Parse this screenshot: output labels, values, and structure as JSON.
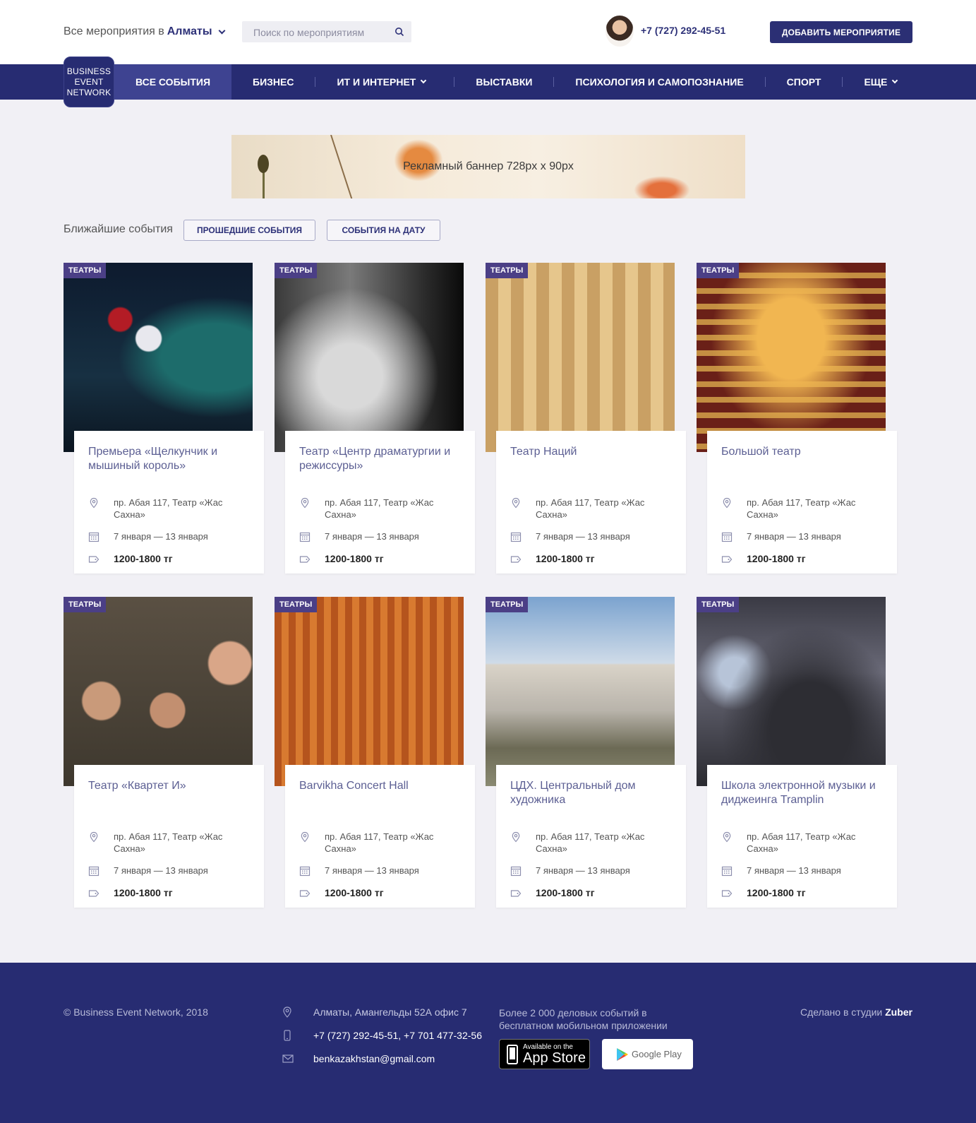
{
  "header": {
    "city_prefix": "Все мероприятия в",
    "city": "Алматы",
    "search_placeholder": "Поиск по мероприятиям",
    "phone": "+7 (727) 292-45-51",
    "add_button": "ДОБАВИТЬ МЕРОПРИЯТИЕ"
  },
  "logo": {
    "line1": "BUSINESS",
    "line2": "EVENT",
    "line3": "NETWORK"
  },
  "nav": {
    "items": [
      {
        "label": "ВСЕ СОБЫТИЯ",
        "active": true
      },
      {
        "label": "БИЗНЕС"
      },
      {
        "label": "ИТ И ИНТЕРНЕТ",
        "dropdown": true
      },
      {
        "label": "ВЫСТАВКИ"
      },
      {
        "label": "ПСИХОЛОГИЯ И САМОПОЗНАНИЕ"
      },
      {
        "label": "СПОРТ"
      },
      {
        "label": "ЕЩЕ",
        "dropdown": true
      }
    ]
  },
  "banner": {
    "text": "Рекламный баннер 728px x 90px"
  },
  "filters": {
    "label": "Ближайшие события",
    "past": "ПРОШЕДШИЕ СОБЫТИЯ",
    "by_date": "СОБЫТИЯ НА ДАТУ"
  },
  "events": [
    {
      "tag": "ТЕАТРЫ",
      "title": "Премьера «Щелкунчик и мышиный король»",
      "address": "пр. Абая 117, Театр «Жас Сахна»",
      "dates": "7 января — 13 января",
      "price": "1200-1800 тг"
    },
    {
      "tag": "ТЕАТРЫ",
      "title": "Театр «Центр драматургии и режиссуры»",
      "address": "пр. Абая 117, Театр «Жас Сахна»",
      "dates": "7 января — 13 января",
      "price": "1200-1800 тг"
    },
    {
      "tag": "ТЕАТРЫ",
      "title": "Театр Наций",
      "address": "пр. Абая 117, Театр «Жас Сахна»",
      "dates": "7 января — 13 января",
      "price": "1200-1800 тг"
    },
    {
      "tag": "ТЕАТРЫ",
      "title": "Большой театр",
      "address": "пр. Абая 117, Театр «Жас Сахна»",
      "dates": "7 января — 13 января",
      "price": "1200-1800 тг"
    },
    {
      "tag": "ТЕАТРЫ",
      "title": "Театр «Квартет И»",
      "address": "пр. Абая 117, Театр «Жас Сахна»",
      "dates": "7 января — 13 января",
      "price": "1200-1800 тг"
    },
    {
      "tag": "ТЕАТРЫ",
      "title": "Barvikha Concert Hall",
      "address": "пр. Абая 117, Театр «Жас Сахна»",
      "dates": "7 января — 13 января",
      "price": "1200-1800 тг"
    },
    {
      "tag": "ТЕАТРЫ",
      "title": "ЦДХ. Центральный дом художника",
      "address": "пр. Абая 117, Театр «Жас Сахна»",
      "dates": "7 января — 13 января",
      "price": "1200-1800 тг"
    },
    {
      "tag": "ТЕАТРЫ",
      "title": "Школа электронной музыки и диджеинга Tramplin",
      "address": "пр. Абая 117, Театр «Жас Сахна»",
      "dates": "7 января — 13 января",
      "price": "1200-1800 тг"
    }
  ],
  "footer": {
    "copyright": "© Business Event Network, 2018",
    "address": "Алматы, Амангельды 52А офис 7",
    "phone1": "+7 (727) 292-45-51",
    "phone2": "+7 701 477-32-56",
    "email": "benkazakhstan@gmail.com",
    "app_text": "Более 2 000 деловых событий в бесплатном мобильном приложении",
    "appstore_small": "Available on the",
    "appstore_big": "App Store",
    "googleplay": "Google Play",
    "studio_prefix": "Сделано в студии",
    "studio": "Zuber"
  },
  "colors": {
    "primary": "#272c72",
    "active_nav": "#3e4391",
    "tag": "#4b3f86",
    "background": "#f1f0f5"
  }
}
